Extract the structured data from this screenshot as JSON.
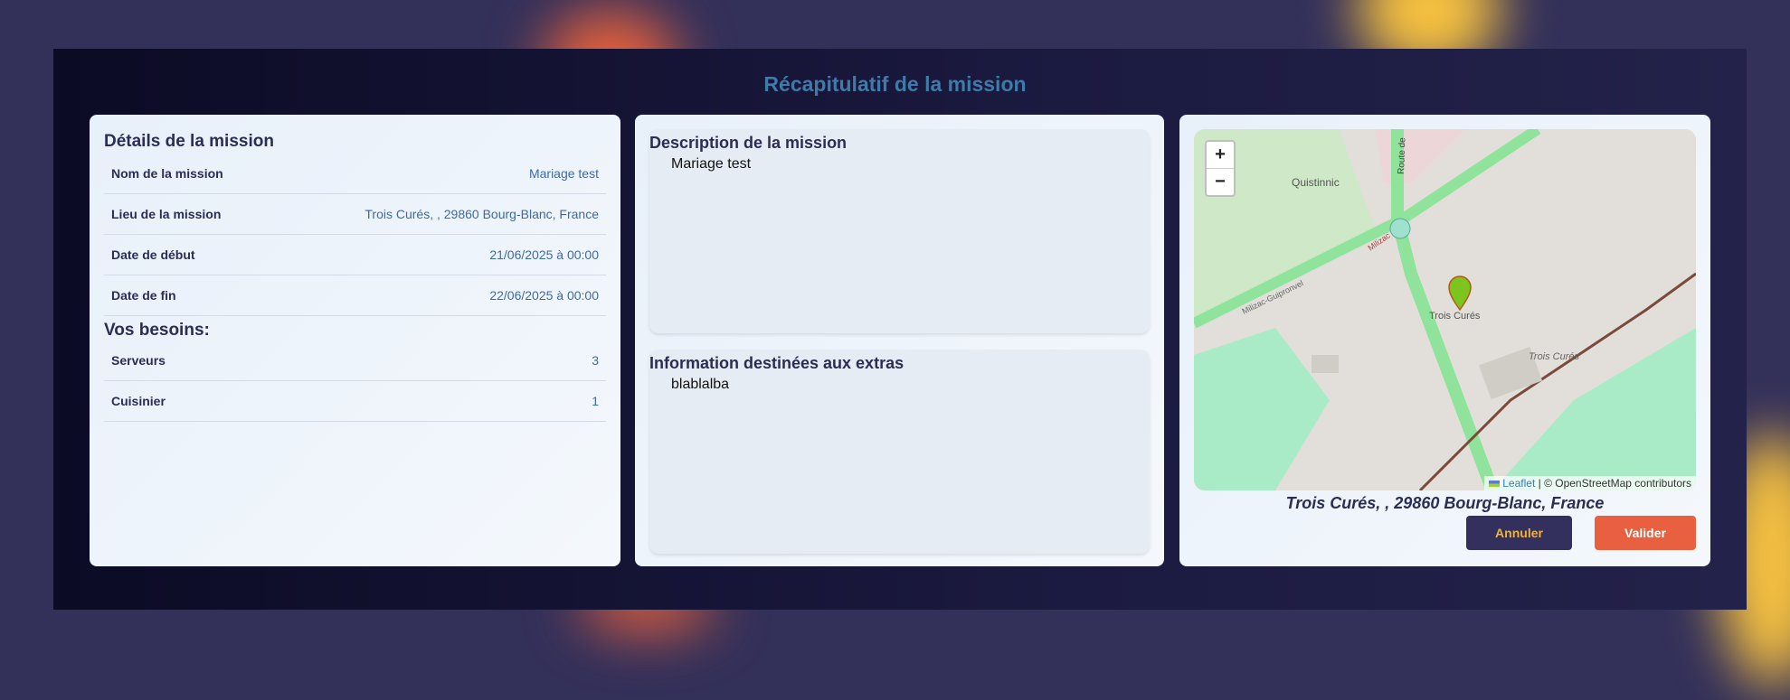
{
  "title": "Récapitulatif de la mission",
  "details": {
    "heading": "Détails de la mission",
    "rows": [
      {
        "label": "Nom de la mission",
        "value": "Mariage test"
      },
      {
        "label": "Lieu de la mission",
        "value": "Trois Curés, , 29860 Bourg-Blanc, France"
      },
      {
        "label": "Date de début",
        "value": "21/06/2025 à 00:00"
      },
      {
        "label": "Date de fin",
        "value": "22/06/2025 à 00:00"
      }
    ]
  },
  "needs": {
    "heading": "Vos besoins:",
    "rows": [
      {
        "label": "Serveurs",
        "value": "3"
      },
      {
        "label": "Cuisinier",
        "value": "1"
      }
    ]
  },
  "description": {
    "heading": "Description de la mission",
    "text": "Mariage test"
  },
  "extras": {
    "heading": "Information destinées aux extras",
    "text": "blablalba"
  },
  "map": {
    "zoom_in": "+",
    "zoom_out": "−",
    "labels": [
      "Quistinnic",
      "Trois Curés",
      "Trois Curés",
      "Route de",
      "Milizac",
      "Milizac-Guipronvel"
    ],
    "attribution_link": "Leaflet",
    "attribution_text": "| © OpenStreetMap contributors",
    "marker_color": "#7cc41e"
  },
  "address": "Trois Curés, , 29860 Bourg-Blanc, France",
  "actions": {
    "cancel": "Annuler",
    "validate": "Valider",
    "cancel_bg": "#33305e",
    "cancel_fg": "#f0b23c",
    "validate_bg": "#e8603f"
  }
}
